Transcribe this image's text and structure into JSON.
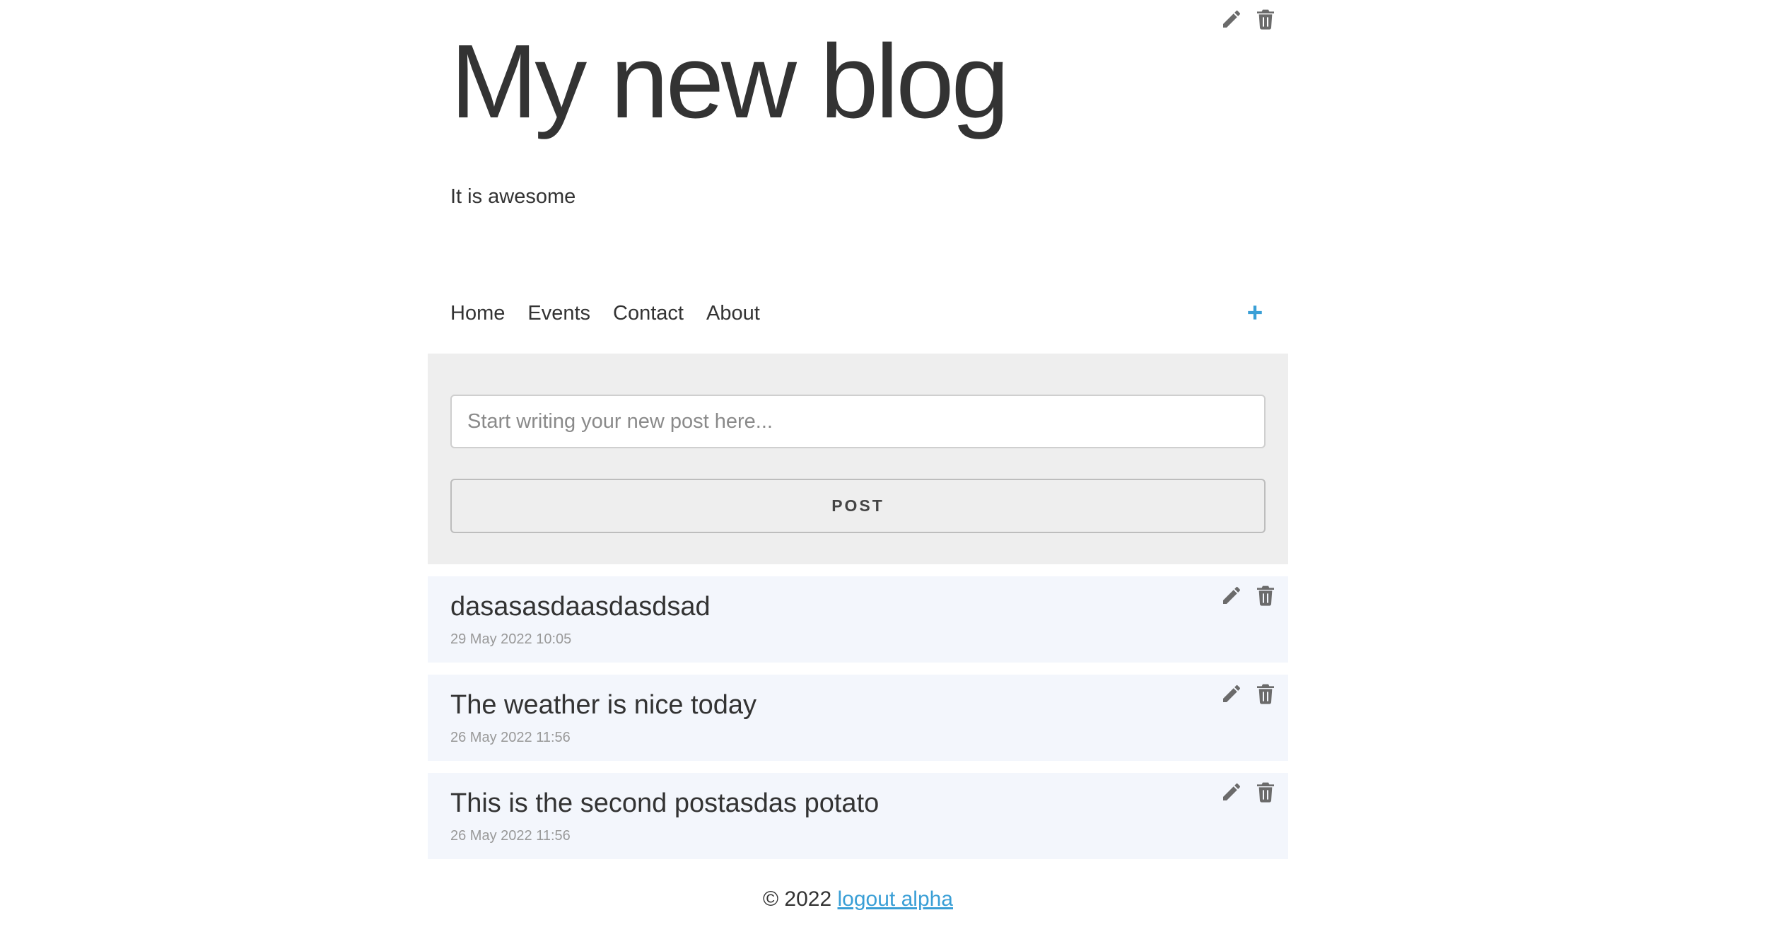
{
  "blog": {
    "title": "My new blog",
    "subtitle": "It is awesome",
    "header_actions": {
      "edit_icon": "pencil-icon",
      "delete_icon": "trash-icon"
    }
  },
  "nav": {
    "items": [
      {
        "label": "Home"
      },
      {
        "label": "Events"
      },
      {
        "label": "Contact"
      },
      {
        "label": "About"
      }
    ],
    "add_icon": "plus-icon",
    "accent_color": "#3a9fd6"
  },
  "composer": {
    "placeholder": "Start writing your new post here...",
    "value": "",
    "post_label": "POST"
  },
  "posts": [
    {
      "title": "dasasasdaasdasdsad",
      "date": "29 May 2022 10:05"
    },
    {
      "title": "The weather is nice today",
      "date": "26 May 2022 11:56"
    },
    {
      "title": "This is the second postasdas potato",
      "date": "26 May 2022 11:56"
    }
  ],
  "footer": {
    "copyright": "© 2022",
    "link_label": "logout alpha"
  }
}
